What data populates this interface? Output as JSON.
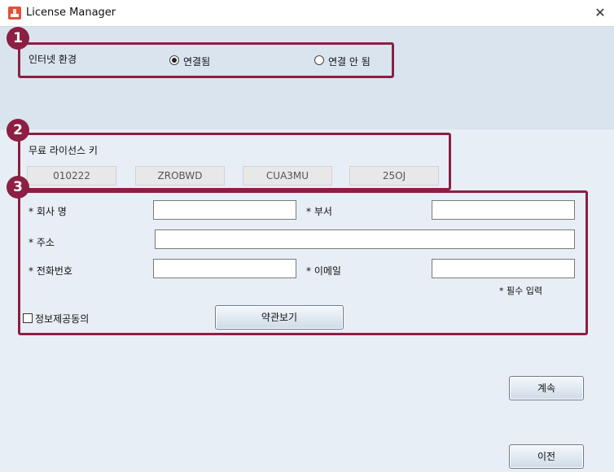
{
  "window": {
    "title": "License Manager",
    "close_glyph": "✕"
  },
  "badges": [
    "1",
    "2",
    "3"
  ],
  "network": {
    "label": "인터넷 환경",
    "options": [
      {
        "label": "연결됨",
        "checked": true
      },
      {
        "label": "연결 안 됨",
        "checked": false
      }
    ]
  },
  "license": {
    "label": "무료 라이선스 키",
    "keys": [
      "010222",
      "ZROBWD",
      "CUA3MU",
      "25OJ"
    ]
  },
  "form": {
    "company_label": "* 회사 명",
    "department_label": "* 부서",
    "address_label": "* 주소",
    "phone_label": "* 전화번호",
    "email_label": "* 이메일",
    "required_note": "* 필수 입력",
    "consent_label": "정보제공동의",
    "consent_checked": false,
    "terms_button": "약관보기",
    "values": {
      "company": "",
      "department": "",
      "address": "",
      "phone": "",
      "email": ""
    }
  },
  "buttons": {
    "continue": "계속",
    "previous": "이전"
  },
  "colors": {
    "accent": "#8c1f43",
    "top_band": "#d9e4ef",
    "main_bg": "#e8eef5"
  }
}
